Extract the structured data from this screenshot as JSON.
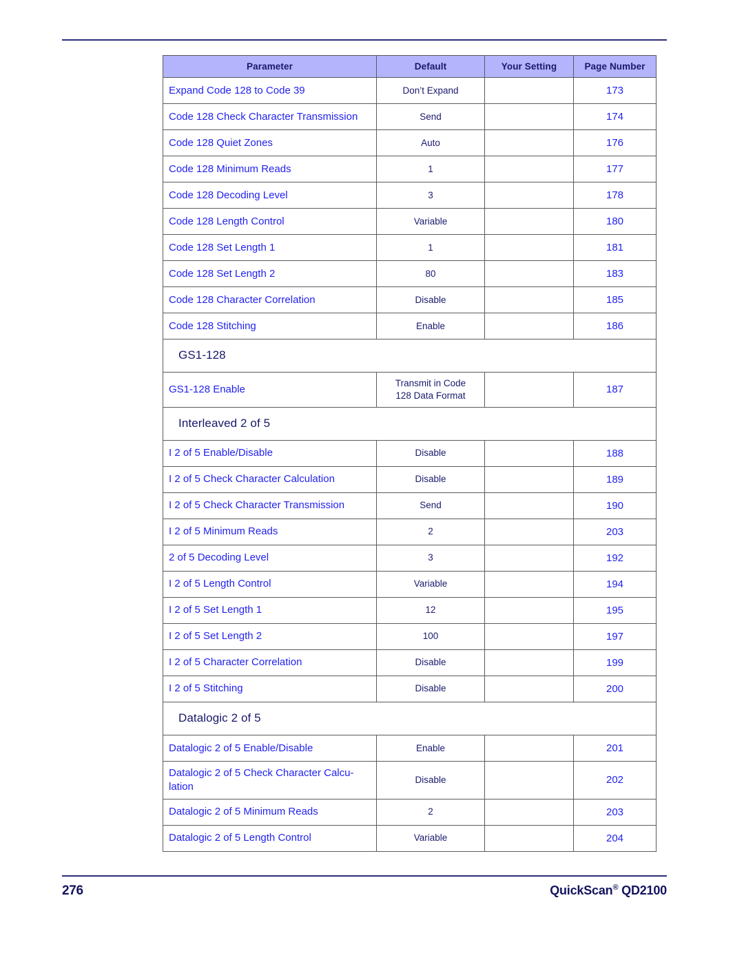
{
  "document": {
    "footer": {
      "page_number": "276",
      "product_name": "QuickScan",
      "registered_mark": "®",
      "product_model": " QD2100"
    }
  },
  "colors": {
    "header_background": "#b4b4fd",
    "header_text": "#18186a",
    "link_text": "#2222ee",
    "default_text": "#1a1a6e",
    "rule": "#2b2b7a",
    "border": "#5a5a5a"
  },
  "table": {
    "columns": [
      {
        "key": "parameter",
        "label": "Parameter"
      },
      {
        "key": "default",
        "label": "Default"
      },
      {
        "key": "your_setting",
        "label": "Your Setting"
      },
      {
        "key": "page_number",
        "label": "Page Number"
      }
    ],
    "rows": [
      {
        "type": "data",
        "parameter": "Expand Code 128 to Code 39",
        "default": "Don’t Expand",
        "your_setting": "",
        "page_number": "173"
      },
      {
        "type": "data",
        "parameter": "Code 128 Check Character Transmission",
        "default": "Send",
        "your_setting": "",
        "page_number": "174"
      },
      {
        "type": "data",
        "parameter": "Code 128 Quiet Zones",
        "default": "Auto",
        "your_setting": "",
        "page_number": "176"
      },
      {
        "type": "data",
        "parameter": "Code 128 Minimum Reads",
        "default": "1",
        "your_setting": "",
        "page_number": "177"
      },
      {
        "type": "data",
        "parameter": "Code 128 Decoding Level",
        "default": "3",
        "your_setting": "",
        "page_number": "178"
      },
      {
        "type": "data",
        "parameter": "Code 128 Length Control",
        "default": "Variable",
        "your_setting": "",
        "page_number": "180"
      },
      {
        "type": "data",
        "parameter": "Code 128 Set Length 1",
        "default": "1",
        "your_setting": "",
        "page_number": "181"
      },
      {
        "type": "data",
        "parameter": "Code 128 Set Length 2",
        "default": "80",
        "your_setting": "",
        "page_number": "183"
      },
      {
        "type": "data",
        "parameter": "Code 128 Character Correlation",
        "default": "Disable",
        "your_setting": "",
        "page_number": "185"
      },
      {
        "type": "data",
        "parameter": "Code 128 Stitching",
        "default": "Enable",
        "your_setting": "",
        "page_number": "186"
      },
      {
        "type": "section",
        "title": "GS1-128"
      },
      {
        "type": "data",
        "parameter": "GS1-128 Enable",
        "default_line1": "Transmit  in Code",
        "default_line2": "128 Data Format",
        "your_setting": "",
        "page_number": "187"
      },
      {
        "type": "section",
        "title": "Interleaved 2 of 5"
      },
      {
        "type": "data",
        "parameter": "I 2 of 5 Enable/Disable",
        "default": "Disable",
        "your_setting": "",
        "page_number": "188"
      },
      {
        "type": "data",
        "parameter": "I 2 of 5 Check Character Calculation",
        "default": "Disable",
        "your_setting": "",
        "page_number": "189"
      },
      {
        "type": "data",
        "parameter": "I 2 of 5 Check Character Transmission",
        "default": "Send",
        "your_setting": "",
        "page_number": "190"
      },
      {
        "type": "data",
        "parameter": "I 2 of 5 Minimum Reads",
        "default": "2",
        "your_setting": "",
        "page_number": "203"
      },
      {
        "type": "data",
        "parameter": "2 of 5 Decoding Level",
        "default": "3",
        "your_setting": "",
        "page_number": "192"
      },
      {
        "type": "data",
        "parameter": "I 2 of 5 Length Control",
        "default": "Variable",
        "your_setting": "",
        "page_number": "194"
      },
      {
        "type": "data",
        "parameter": "I 2 of 5 Set Length 1",
        "default": "12",
        "your_setting": "",
        "page_number": "195"
      },
      {
        "type": "data",
        "parameter": "I 2 of 5 Set Length 2",
        "default": "100",
        "your_setting": "",
        "page_number": "197"
      },
      {
        "type": "data",
        "parameter": "I 2 of 5 Character Correlation",
        "default": "Disable",
        "your_setting": "",
        "page_number": "199"
      },
      {
        "type": "data",
        "parameter": "I 2 of 5 Stitching",
        "default": "Disable",
        "your_setting": "",
        "page_number": "200"
      },
      {
        "type": "section",
        "title": "Datalogic 2 of 5"
      },
      {
        "type": "data",
        "parameter": "Datalogic 2 of 5 Enable/Disable",
        "default": "Enable",
        "your_setting": "",
        "page_number": "201"
      },
      {
        "type": "data",
        "parameter": "Datalogic 2 of 5 Check Character Calcu-lation",
        "default": "Disable",
        "your_setting": "",
        "page_number": "202"
      },
      {
        "type": "data",
        "parameter": "Datalogic 2 of 5 Minimum Reads",
        "default": "2",
        "your_setting": "",
        "page_number": "203"
      },
      {
        "type": "data",
        "parameter": "Datalogic 2 of 5 Length Control",
        "default": "Variable",
        "your_setting": "",
        "page_number": "204"
      }
    ]
  }
}
